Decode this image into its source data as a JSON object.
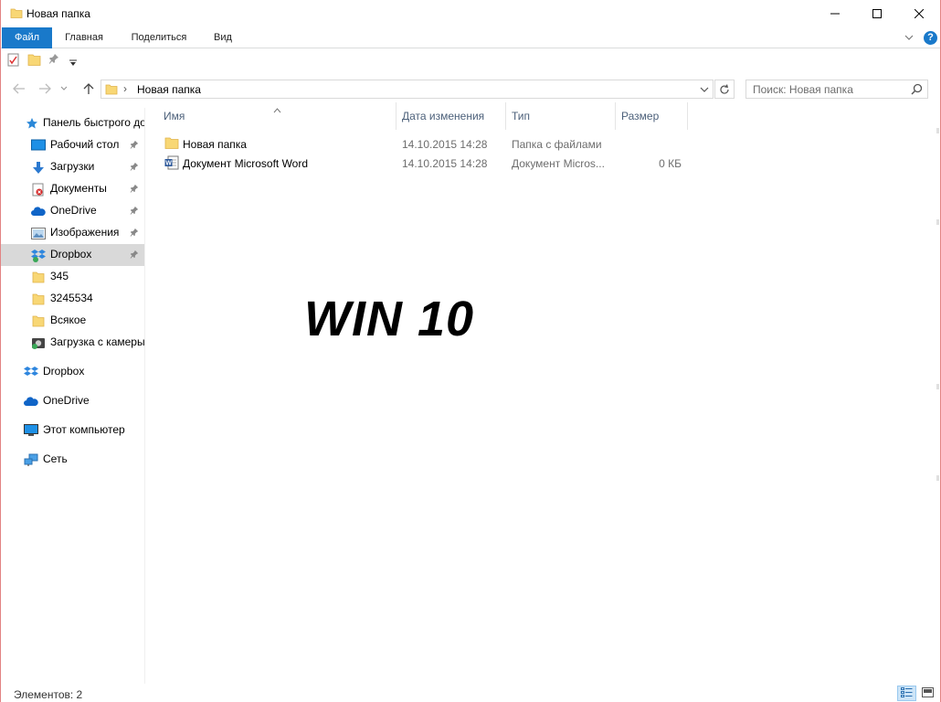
{
  "window": {
    "title": "Новая папка",
    "controls": {
      "minimize": "minimize",
      "maximize": "maximize",
      "close": "close"
    }
  },
  "ribbon": {
    "tabs": [
      {
        "label": "Файл",
        "active": true
      },
      {
        "label": "Главная",
        "active": false
      },
      {
        "label": "Поделиться",
        "active": false
      },
      {
        "label": "Вид",
        "active": false
      }
    ],
    "help": "?"
  },
  "quick_access": {
    "icons": [
      "properties-icon",
      "new-folder-icon",
      "pin-icon",
      "customize-dropdown-icon"
    ]
  },
  "address_bar": {
    "separator": "›",
    "path": "Новая папка",
    "search_placeholder": "Поиск: Новая папка"
  },
  "nav_pane": {
    "quick_access_label": "Панель быстрого доступа",
    "pinned": [
      {
        "label": "Рабочий стол",
        "icon": "desktop-icon",
        "pinned": true
      },
      {
        "label": "Загрузки",
        "icon": "downloads-icon",
        "pinned": true
      },
      {
        "label": "Документы",
        "icon": "documents-icon",
        "pinned": true
      },
      {
        "label": "OneDrive",
        "icon": "onedrive-icon",
        "pinned": true
      },
      {
        "label": "Изображения",
        "icon": "pictures-icon",
        "pinned": true
      },
      {
        "label": "Dropbox",
        "icon": "dropbox-icon",
        "pinned": true,
        "selected": true
      },
      {
        "label": "345",
        "icon": "folder-icon",
        "pinned": false
      },
      {
        "label": "3245534",
        "icon": "folder-icon",
        "pinned": false
      },
      {
        "label": "Всякое",
        "icon": "folder-icon",
        "pinned": false
      },
      {
        "label": "Загрузка с камеры",
        "icon": "camera-roll-icon",
        "pinned": false
      }
    ],
    "roots": [
      {
        "label": "Dropbox",
        "icon": "dropbox-icon"
      },
      {
        "label": "OneDrive",
        "icon": "onedrive-icon"
      },
      {
        "label": "Этот компьютер",
        "icon": "computer-icon"
      },
      {
        "label": "Сеть",
        "icon": "network-icon"
      }
    ]
  },
  "file_list": {
    "columns": [
      "Имя",
      "Дата изменения",
      "Тип",
      "Размер"
    ],
    "sort_column": "Имя",
    "rows": [
      {
        "name": "Новая папка",
        "icon": "folder-icon",
        "date": "14.10.2015 14:28",
        "type": "Папка с файлами",
        "size": ""
      },
      {
        "name": "Документ Microsoft Word",
        "icon": "word-doc-icon",
        "date": "14.10.2015 14:28",
        "type": "Документ Micros...",
        "size": "0 КБ"
      }
    ]
  },
  "overlay_text": "WIN 10",
  "status_bar": {
    "items_count": "Элементов: 2",
    "views": [
      "details-view",
      "tiles-view"
    ]
  },
  "colors": {
    "file_tab": "#1979ca",
    "selection": "#d9d9d9",
    "header_text": "#4c607a",
    "window_border": "#e28383"
  }
}
